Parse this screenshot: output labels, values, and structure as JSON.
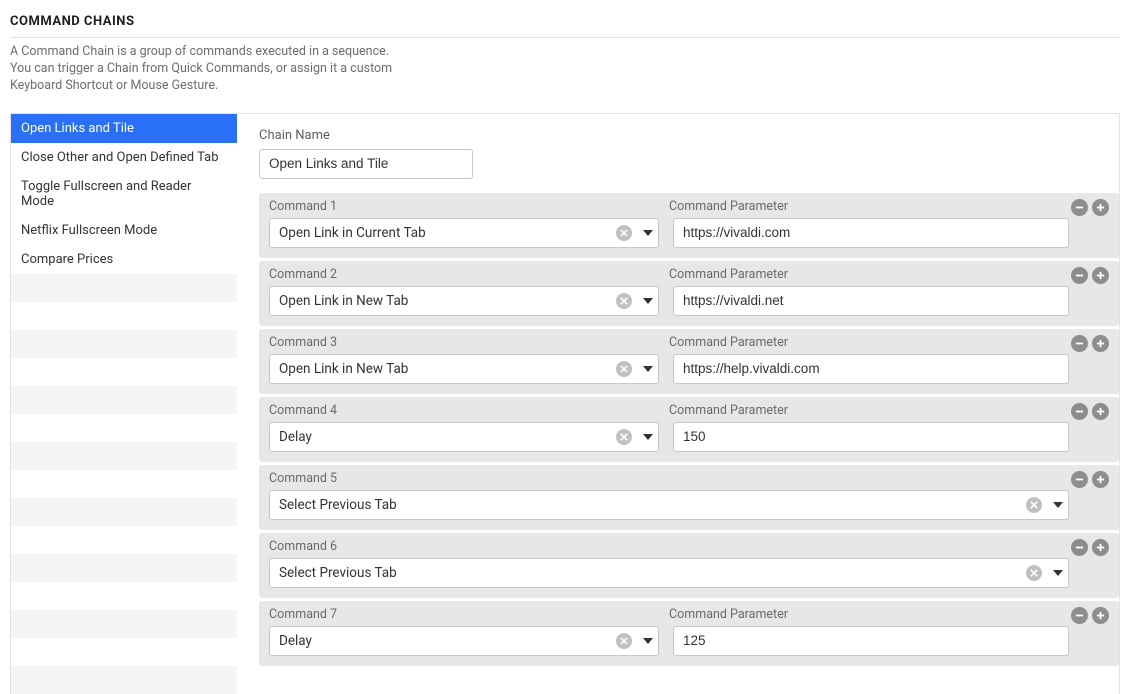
{
  "heading": "COMMAND CHAINS",
  "intro": "A Command Chain is a group of commands executed in a sequence. You can trigger a Chain from Quick Commands, or assign it a custom Keyboard Shortcut or Mouse Gesture.",
  "sidebar": {
    "items": [
      {
        "label": "Open Links and Tile",
        "selected": true
      },
      {
        "label": "Close Other and Open Defined Tab",
        "selected": false
      },
      {
        "label": "Toggle Fullscreen and Reader Mode",
        "selected": false
      },
      {
        "label": "Netflix Fullscreen Mode",
        "selected": false
      },
      {
        "label": "Compare Prices",
        "selected": false
      }
    ]
  },
  "form": {
    "chain_name_label": "Chain Name",
    "chain_name_value": "Open Links and Tile",
    "command_label_prefix": "Command",
    "parameter_label": "Command Parameter",
    "commands": [
      {
        "num": "1",
        "command": "Open Link in Current Tab",
        "has_param": true,
        "param": "https://vivaldi.com"
      },
      {
        "num": "2",
        "command": "Open Link in New Tab",
        "has_param": true,
        "param": "https://vivaldi.net"
      },
      {
        "num": "3",
        "command": "Open Link in New Tab",
        "has_param": true,
        "param": "https://help.vivaldi.com"
      },
      {
        "num": "4",
        "command": "Delay",
        "has_param": true,
        "param": "150"
      },
      {
        "num": "5",
        "command": "Select Previous Tab",
        "has_param": false,
        "param": ""
      },
      {
        "num": "6",
        "command": "Select Previous Tab",
        "has_param": false,
        "param": ""
      },
      {
        "num": "7",
        "command": "Delay",
        "has_param": true,
        "param": "125"
      }
    ]
  }
}
